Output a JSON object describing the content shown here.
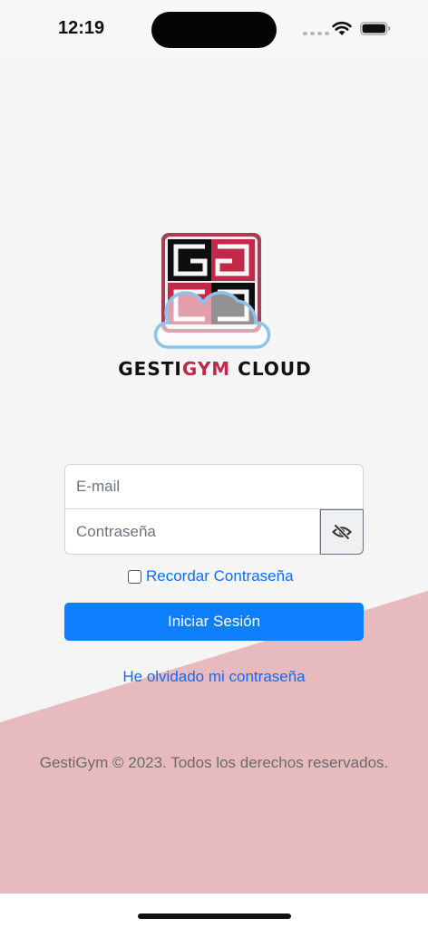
{
  "status_bar": {
    "time": "12:19"
  },
  "brand": {
    "logo_text": "GESTIGYM CLOUD"
  },
  "form": {
    "email_placeholder": "E-mail",
    "password_placeholder": "Contraseña",
    "remember_label": "Recordar Contraseña",
    "remember_checked": false,
    "login_label": "Iniciar Sesión",
    "forgot_label": "He olvidado mi contraseña"
  },
  "footer": {
    "text": "GestiGym © 2023. Todos los derechos reservados."
  },
  "colors": {
    "background": "#f5f5f5",
    "accent_pink": "#e7babf",
    "primary_blue": "#0d7efc",
    "link_blue": "#0d6efd",
    "logo_red": "#b02a45",
    "cloud_blue": "#8cc3ea"
  },
  "icons": [
    "wifi-icon",
    "battery-icon",
    "eye-slash-icon"
  ]
}
